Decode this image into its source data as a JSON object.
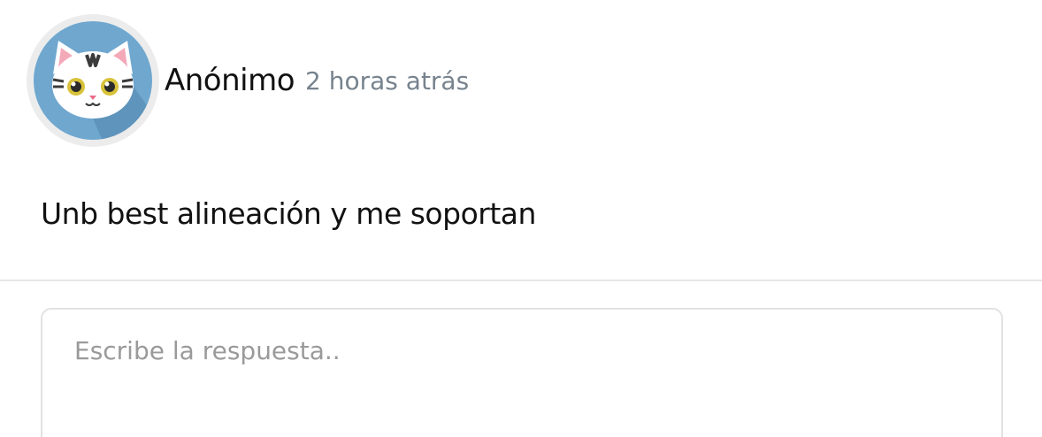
{
  "post": {
    "author": "Anónimo",
    "time": "2 horas atrás",
    "avatar_icon": "cat-avatar-icon",
    "text": "Unb best alineación y me soportan"
  },
  "reply": {
    "placeholder": "Escribe la respuesta..",
    "value": ""
  },
  "colors": {
    "avatar_bg": "#6fa7cf",
    "avatar_ring": "#ececec",
    "time_text": "#77838e",
    "placeholder": "#9a9a9a"
  }
}
